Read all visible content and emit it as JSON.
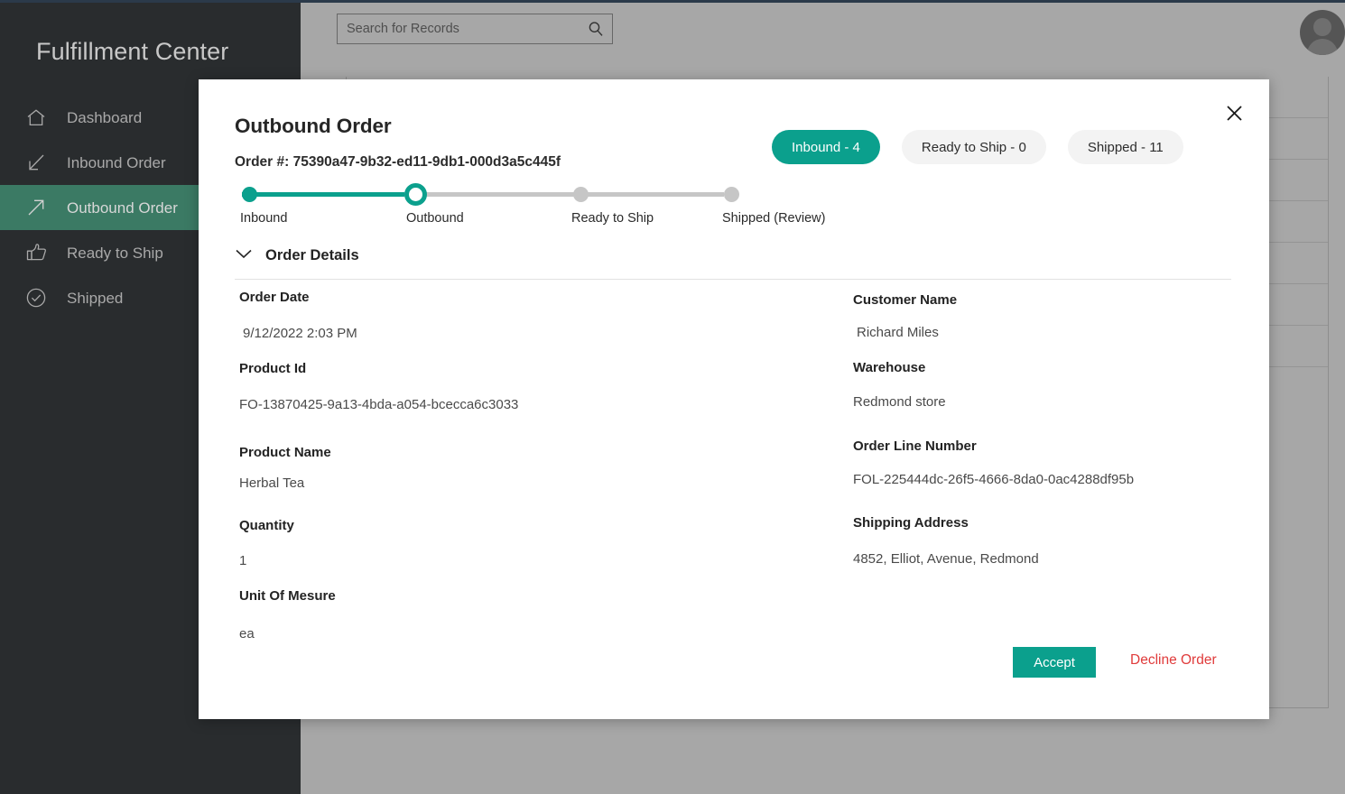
{
  "sidebar": {
    "brand": "Fulfillment Center",
    "items": [
      {
        "label": "Dashboard",
        "icon": "home-icon",
        "active": false
      },
      {
        "label": "Inbound Order",
        "icon": "arrow-down-left-icon",
        "active": false
      },
      {
        "label": "Outbound Order",
        "icon": "arrow-up-right-icon",
        "active": true
      },
      {
        "label": "Ready to Ship",
        "icon": "thumbs-up-icon",
        "active": false
      },
      {
        "label": "Shipped",
        "icon": "check-circle-icon",
        "active": false
      }
    ]
  },
  "header": {
    "search_placeholder": "Search for Records",
    "search_value": "",
    "search_icon": "search-icon",
    "avatar_icon": "user-avatar-icon"
  },
  "modal": {
    "title": "Outbound Order",
    "order_number_label": "Order #: 75390a47-9b32-ed11-9db1-000d3a5c445f",
    "close_icon": "close-icon",
    "chevron_icon": "chevron-down-icon",
    "section_title": "Order Details",
    "pills": [
      {
        "label": "Inbound - 4",
        "active": true
      },
      {
        "label": "Ready to Ship - 0",
        "active": false
      },
      {
        "label": "Shipped - 11",
        "active": false
      }
    ],
    "steps": [
      {
        "label": "Inbound",
        "state": "done"
      },
      {
        "label": "Outbound",
        "state": "current"
      },
      {
        "label": "Ready to Ship",
        "state": "pending"
      },
      {
        "label": "Shipped (Review)",
        "state": "pending"
      }
    ],
    "fields_left": [
      {
        "label": "Order Date",
        "value": "9/12/2022 2:03 PM"
      },
      {
        "label": "Product Id",
        "value": "FO-13870425-9a13-4bda-a054-bcecca6c3033"
      },
      {
        "label": "Product Name",
        "value": "Herbal Tea"
      },
      {
        "label": "Quantity",
        "value": "1"
      },
      {
        "label": "Unit Of Mesure",
        "value": "ea"
      }
    ],
    "fields_right": [
      {
        "label": "Customer Name",
        "value": "Richard Miles"
      },
      {
        "label": "Warehouse",
        "value": "Redmond store"
      },
      {
        "label": "Order Line Number",
        "value": "FOL-225444dc-26f5-4666-8da0-0ac4288df95b"
      },
      {
        "label": "Shipping Address",
        "value": "4852, Elliot, Avenue, Redmond"
      }
    ],
    "accept_label": "Accept",
    "decline_label": "Decline Order"
  },
  "colors": {
    "accent_teal": "#0ba08d",
    "sidebar_bg": "#292c2e",
    "sidebar_active": "#3b7a64",
    "danger_red": "#e03b3b"
  }
}
